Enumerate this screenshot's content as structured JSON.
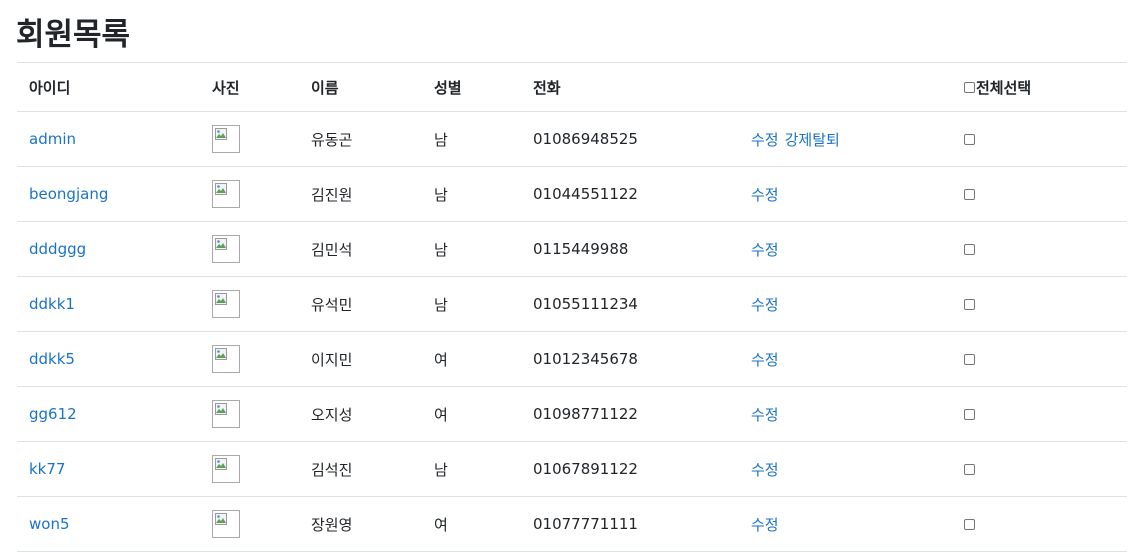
{
  "page": {
    "title": "회원목록"
  },
  "table": {
    "headers": {
      "id": "아이디",
      "photo": "사진",
      "name": "이름",
      "gender": "성별",
      "phone": "전화",
      "actions": "",
      "select_all": "전체선택"
    },
    "rows": [
      {
        "id": "admin",
        "name": "유동곤",
        "gender": "남",
        "phone": "01086948525",
        "edit": "수정",
        "force_withdraw": "강제탈퇴",
        "checked": false
      },
      {
        "id": "beongjang",
        "name": "김진원",
        "gender": "남",
        "phone": "01044551122",
        "edit": "수정",
        "force_withdraw": "",
        "checked": false
      },
      {
        "id": "dddggg",
        "name": "김민석",
        "gender": "남",
        "phone": "0115449988",
        "edit": "수정",
        "force_withdraw": "",
        "checked": false
      },
      {
        "id": "ddkk1",
        "name": "유석민",
        "gender": "남",
        "phone": "01055111234",
        "edit": "수정",
        "force_withdraw": "",
        "checked": false
      },
      {
        "id": "ddkk5",
        "name": "이지민",
        "gender": "여",
        "phone": "01012345678",
        "edit": "수정",
        "force_withdraw": "",
        "checked": false
      },
      {
        "id": "gg612",
        "name": "오지성",
        "gender": "여",
        "phone": "01098771122",
        "edit": "수정",
        "force_withdraw": "",
        "checked": false
      },
      {
        "id": "kk77",
        "name": "김석진",
        "gender": "남",
        "phone": "01067891122",
        "edit": "수정",
        "force_withdraw": "",
        "checked": false
      },
      {
        "id": "won5",
        "name": "장원영",
        "gender": "여",
        "phone": "01077771111",
        "edit": "수정",
        "force_withdraw": "",
        "checked": false
      }
    ]
  },
  "colors": {
    "link": "#1a73c8",
    "text": "#212529",
    "border": "#dee2e6"
  },
  "icons": {
    "photo": "broken-image-icon",
    "checkbox": "checkbox-icon"
  }
}
